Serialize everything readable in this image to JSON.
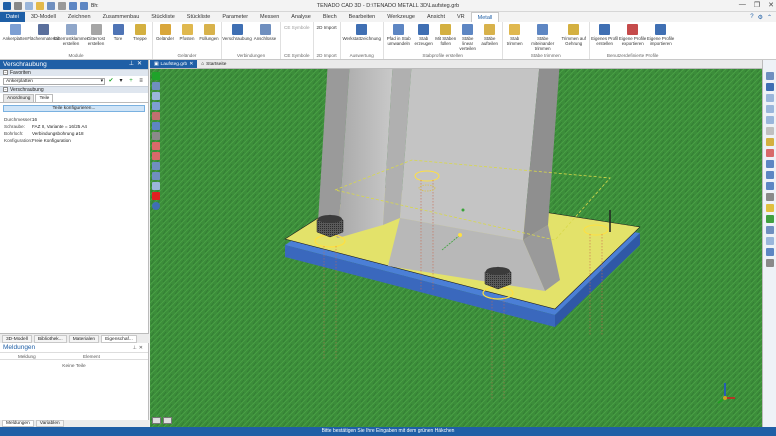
{
  "window": {
    "title": "TENADO CAD 3D - D:\\TENADO METALL 3D\\Laufsteg.grb",
    "search_label": "Bh:",
    "controls": [
      "—",
      "❐",
      "✕"
    ]
  },
  "menu": {
    "tabs": [
      "Datei",
      "3D-Modell",
      "Zeichnen",
      "Zusammenbau",
      "Stückliste",
      "Stückliste",
      "Parameter",
      "Messen",
      "Analyse",
      "Blech",
      "Bearbeiten",
      "Werkzeuge",
      "Ansicht",
      "VR",
      "Metall"
    ],
    "active": "Metall"
  },
  "ribbon": {
    "groups": [
      {
        "label": "Module",
        "items": [
          "Ankerplatten",
          "Flächenmaterial",
          "Gitterrostklammer erstellen",
          "Gitterrost erstellen",
          "Tore",
          "Treppe"
        ]
      },
      {
        "label": "Geländer",
        "items": [
          "Geländer",
          "Pfosten",
          "Füllungen"
        ]
      },
      {
        "label": "Verbindungen",
        "items": [
          "Verschraubung",
          "Anschlüsse"
        ]
      },
      {
        "label": "CE Symbole",
        "items": [
          "CE Symbole"
        ]
      },
      {
        "label": "2D Import",
        "items": [
          "2D Import"
        ]
      },
      {
        "label": "Auswertung",
        "items": [
          "Werkstattzeichnung"
        ]
      },
      {
        "label": "Stabprofile erstellen",
        "items": [
          "Pfad in Stab umwandeln",
          "Stab erzeugen",
          "Mit Stäben füllen",
          "Stäbe linear verteilen",
          "Stäbe aufteilen"
        ]
      },
      {
        "label": "Stäbe trimmen",
        "items": [
          "Stab trimmen",
          "Stäbe miteinander trimmen",
          "Trimmen auf Gehrung"
        ]
      },
      {
        "label": "Benutzerdefinierte Profile",
        "items": [
          "Eigenes Profil erstellen",
          "Eigene Profile exportieren",
          "Eigene Profile importieren"
        ]
      }
    ]
  },
  "left_panel": {
    "title": "Verschraubung",
    "favorites_label": "Favoriten",
    "favorites_value": "Ankerplatten",
    "section_label": "Verschraubung",
    "tabs": [
      "Anordnung",
      "Teile"
    ],
    "active_tab": "Teile",
    "configure_button": "Teile konfigurieren...",
    "properties": [
      {
        "k": "Durchmesser:",
        "v": "16"
      },
      {
        "k": "Schraube:",
        "v": "FAZ II, Variante = 16/25 A4"
      },
      {
        "k": "Bohrloch:",
        "v": "Verbindungsbohrung ø18"
      },
      {
        "k": "Konfiguration:",
        "v": "Freie Konfiguration"
      }
    ]
  },
  "left_bottom_tabs": [
    "3D-Modell",
    "Bibliothek...",
    "Materialen",
    "Eigenschaf..."
  ],
  "messages": {
    "title": "Meldungen",
    "columns": [
      "Meldung",
      "Element"
    ],
    "empty": "Keine Teile"
  },
  "left_foot_tabs": [
    "Meldungen",
    "Variablen"
  ],
  "viewport": {
    "tabs": [
      "Laufsteg.grb",
      "Startseite"
    ]
  },
  "status": {
    "text": "Bitte bestätigen Sie Ihre Eingaben mit dem grünen Häkchen"
  },
  "colors": {
    "brand": "#1f5fa6",
    "ground": "#3c8d3a",
    "plate": "#e3e26a",
    "plate_edge": "#4b7fd6",
    "column": "#b8b8b8",
    "accept": "#1fa32a",
    "cancel": "#e02020"
  }
}
